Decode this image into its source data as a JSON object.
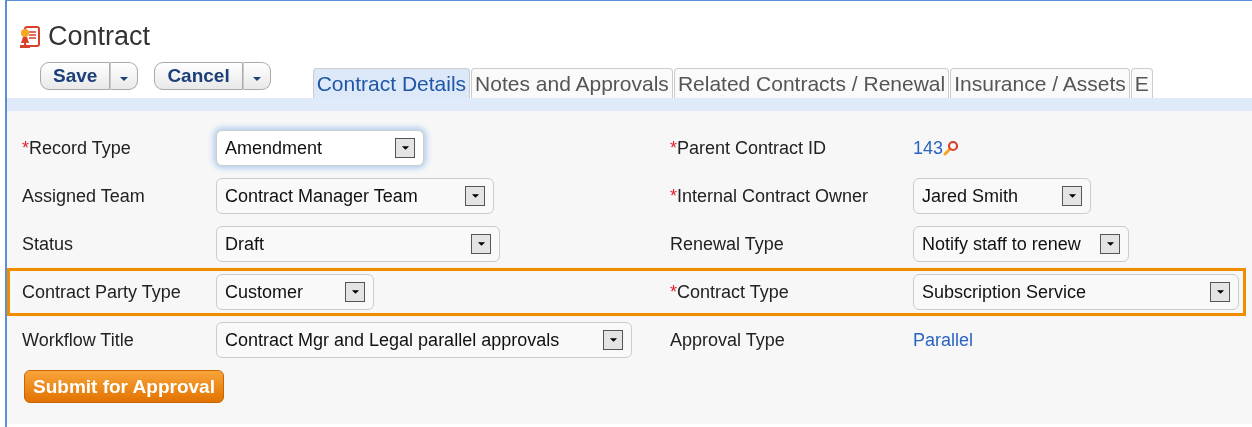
{
  "title": "Contract",
  "actions": [
    {
      "label": "Save"
    },
    {
      "label": "Cancel"
    }
  ],
  "tabs": [
    {
      "label": "Contract Details",
      "selected": true
    },
    {
      "label": "Notes and Approvals",
      "selected": false
    },
    {
      "label": "Related Contracts / Renewal",
      "selected": false
    },
    {
      "label": "Insurance / Assets",
      "selected": false
    },
    {
      "label": "E",
      "selected": false
    }
  ],
  "rows": [
    {
      "highlighted": false,
      "fields": [
        {
          "label": "Record Type",
          "marker": "*",
          "kind": "select",
          "value": "Amendment",
          "focused": true
        },
        {
          "label": "Parent Contract ID",
          "marker": "*",
          "kind": "lookup",
          "value": "143"
        }
      ]
    },
    {
      "highlighted": false,
      "fields": [
        {
          "label": "Assigned Team",
          "kind": "select",
          "value": "Contract Manager Team",
          "focused": false
        },
        {
          "label": "Internal Contract Owner",
          "marker": "*",
          "kind": "select",
          "value": "Jared Smith",
          "focused": false
        }
      ]
    },
    {
      "highlighted": false,
      "fields": [
        {
          "label": "Status",
          "kind": "select",
          "value": "Draft",
          "focused": false
        },
        {
          "label": "Renewal Type",
          "kind": "select",
          "value": "Notify staff to renew",
          "focused": false
        }
      ]
    },
    {
      "highlighted": true,
      "fields": [
        {
          "label": "Contract Party Type",
          "kind": "select",
          "value": "Customer",
          "focused": false
        },
        {
          "label": "Contract Type",
          "marker": "*",
          "kind": "select",
          "value": "Subscription Service",
          "focused": false
        }
      ]
    },
    {
      "highlighted": false,
      "fields": [
        {
          "label": "Workflow Title",
          "kind": "select",
          "value": "Contract Mgr and Legal parallel approvals",
          "focused": false
        },
        {
          "label": "Approval Type",
          "kind": "link",
          "value": "Parallel"
        }
      ]
    }
  ],
  "submit": {
    "label": "Submit for Approval"
  }
}
